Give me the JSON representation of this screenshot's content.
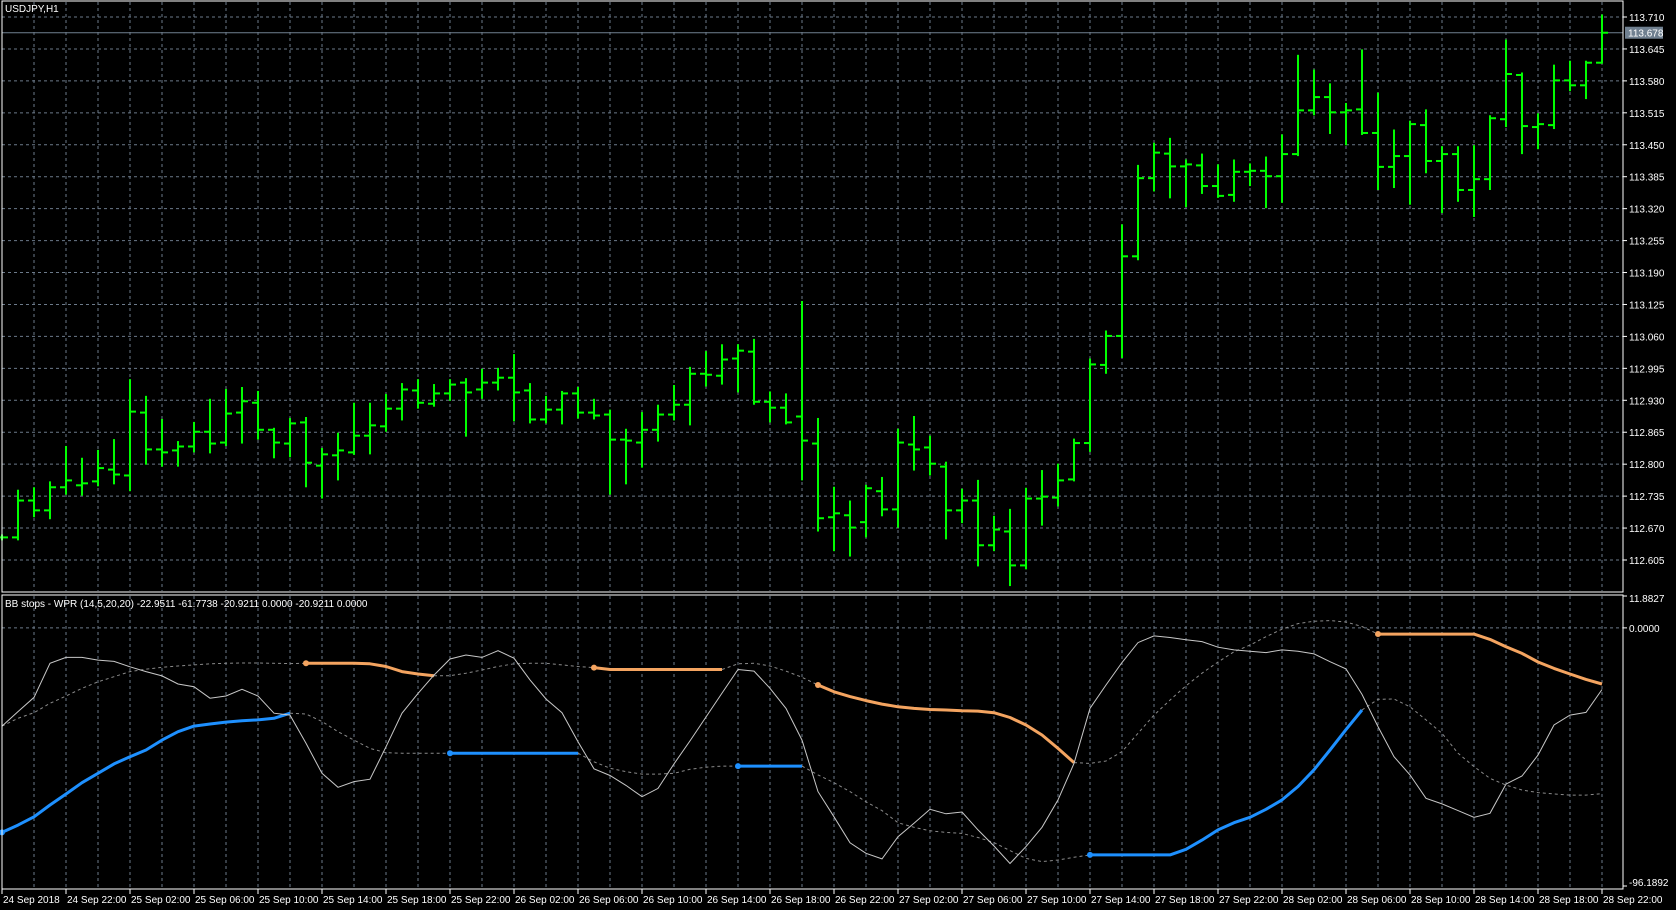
{
  "window": {
    "title": "USDJPY,H1"
  },
  "colors": {
    "background": "#000000",
    "bars": "#00ff00",
    "grid": "#6c7a8a",
    "upper_stop": "#f4a460",
    "lower_stop": "#1e90ff",
    "wpr": "#c8c8c8",
    "inactive": "#8a8a8a",
    "price_line": "#708090"
  },
  "chart_data": [
    {
      "type": "ohlc",
      "symbol": "USDJPY",
      "timeframe": "H1",
      "ylim": [
        112.605,
        113.71
      ],
      "current_price": 113.678,
      "current_price_label": "113.678",
      "y_ticks": [
        "113.710",
        "113.645",
        "113.580",
        "113.515",
        "113.450",
        "113.385",
        "113.320",
        "113.255",
        "113.190",
        "113.125",
        "113.060",
        "112.995",
        "112.930",
        "112.865",
        "112.800",
        "112.735",
        "112.670",
        "112.605"
      ],
      "x_labels": [
        "24 Sep 2018",
        "24 Sep 22:00",
        "25 Sep 02:00",
        "25 Sep 06:00",
        "25 Sep 10:00",
        "25 Sep 14:00",
        "25 Sep 18:00",
        "25 Sep 22:00",
        "26 Sep 02:00",
        "26 Sep 06:00",
        "26 Sep 10:00",
        "26 Sep 14:00",
        "26 Sep 18:00",
        "26 Sep 22:00",
        "27 Sep 02:00",
        "27 Sep 06:00",
        "27 Sep 10:00",
        "27 Sep 14:00",
        "27 Sep 18:00",
        "27 Sep 22:00",
        "28 Sep 02:00",
        "28 Sep 06:00",
        "28 Sep 10:00",
        "28 Sep 14:00",
        "28 Sep 18:00",
        "28 Sep 22:00"
      ],
      "ohlc": [
        [
          112.651,
          112.655,
          112.647,
          112.651
        ],
        [
          112.651,
          112.746,
          112.647,
          112.726
        ],
        [
          112.726,
          112.751,
          112.694,
          112.706
        ],
        [
          112.706,
          112.763,
          112.69,
          112.753
        ],
        [
          112.753,
          112.835,
          112.74,
          112.767
        ],
        [
          112.757,
          112.811,
          112.738,
          112.761
        ],
        [
          112.765,
          112.827,
          112.757,
          112.792
        ],
        [
          112.789,
          112.849,
          112.761,
          112.779
        ],
        [
          112.777,
          112.971,
          112.747,
          112.907
        ],
        [
          112.905,
          112.937,
          112.801,
          112.83
        ],
        [
          112.83,
          112.89,
          112.797,
          112.824
        ],
        [
          112.828,
          112.845,
          112.797,
          112.836
        ],
        [
          112.836,
          112.884,
          112.826,
          112.866
        ],
        [
          112.866,
          112.931,
          112.824,
          112.842
        ],
        [
          112.844,
          112.951,
          112.839,
          112.903
        ],
        [
          112.905,
          112.955,
          112.844,
          112.928
        ],
        [
          112.925,
          112.947,
          112.852,
          112.87
        ],
        [
          112.87,
          112.872,
          112.814,
          112.844
        ],
        [
          112.842,
          112.892,
          112.816,
          112.883
        ],
        [
          112.885,
          112.894,
          112.755,
          112.803
        ],
        [
          112.797,
          112.831,
          112.732,
          112.82
        ],
        [
          112.818,
          112.862,
          112.769,
          112.828
        ],
        [
          112.824,
          112.923,
          112.821,
          112.858
        ],
        [
          112.858,
          112.923,
          112.822,
          112.879
        ],
        [
          112.877,
          112.941,
          112.868,
          112.913
        ],
        [
          112.913,
          112.963,
          112.891,
          112.952
        ],
        [
          112.95,
          112.971,
          112.915,
          112.925
        ],
        [
          112.923,
          112.961,
          112.919,
          112.944
        ],
        [
          112.944,
          112.971,
          112.931,
          112.962
        ],
        [
          112.966,
          112.973,
          112.858,
          112.946
        ],
        [
          112.952,
          112.992,
          112.935,
          112.966
        ],
        [
          112.966,
          112.994,
          112.952,
          112.976
        ],
        [
          112.976,
          113.022,
          112.889,
          112.946
        ],
        [
          112.95,
          112.963,
          112.885,
          112.891
        ],
        [
          112.891,
          112.937,
          112.885,
          112.911
        ],
        [
          112.911,
          112.947,
          112.883,
          112.944
        ],
        [
          112.944,
          112.955,
          112.895,
          112.905
        ],
        [
          112.905,
          112.931,
          112.893,
          112.899
        ],
        [
          112.901,
          112.909,
          112.74,
          112.85
        ],
        [
          112.85,
          112.87,
          112.761,
          112.848
        ],
        [
          112.844,
          112.904,
          112.795,
          112.87
        ],
        [
          112.87,
          112.919,
          112.848,
          112.901
        ],
        [
          112.901,
          112.959,
          112.891,
          112.921
        ],
        [
          112.921,
          112.996,
          112.881,
          112.984
        ],
        [
          112.984,
          113.028,
          112.96,
          112.982
        ],
        [
          112.98,
          113.042,
          112.964,
          113.013
        ],
        [
          113.015,
          113.042,
          112.948,
          113.031
        ],
        [
          113.029,
          113.053,
          112.923,
          112.927
        ],
        [
          112.927,
          112.946,
          112.887,
          112.915
        ],
        [
          112.915,
          112.942,
          112.883,
          112.885
        ],
        [
          112.897,
          113.13,
          112.769,
          112.848
        ],
        [
          112.842,
          112.892,
          112.665,
          112.69
        ],
        [
          112.692,
          112.752,
          112.625,
          112.7
        ],
        [
          112.696,
          112.724,
          112.614,
          112.671
        ],
        [
          112.682,
          112.756,
          112.653,
          112.751
        ],
        [
          112.745,
          112.772,
          112.696,
          112.708
        ],
        [
          112.708,
          112.87,
          112.673,
          112.844
        ],
        [
          112.84,
          112.896,
          112.789,
          112.83
        ],
        [
          112.834,
          112.856,
          112.779,
          112.801
        ],
        [
          112.795,
          112.803,
          112.649,
          112.706
        ],
        [
          112.706,
          112.748,
          112.682,
          112.726
        ],
        [
          112.726,
          112.766,
          112.594,
          112.635
        ],
        [
          112.635,
          112.693,
          112.625,
          112.667
        ],
        [
          112.663,
          112.707,
          112.554,
          112.594
        ],
        [
          112.594,
          112.75,
          112.588,
          112.73
        ],
        [
          112.73,
          112.786,
          112.677,
          112.734
        ],
        [
          112.732,
          112.799,
          112.716,
          112.767
        ],
        [
          112.769,
          112.85,
          112.767,
          112.843
        ],
        [
          112.843,
          113.013,
          112.827,
          113.003
        ],
        [
          113.002,
          113.07,
          112.986,
          113.061
        ],
        [
          113.061,
          113.286,
          113.018,
          113.223
        ],
        [
          113.223,
          113.407,
          113.217,
          113.382
        ],
        [
          113.382,
          113.452,
          113.357,
          113.434
        ],
        [
          113.432,
          113.462,
          113.343,
          113.406
        ],
        [
          113.406,
          113.418,
          113.325,
          113.41
        ],
        [
          113.408,
          113.43,
          113.352,
          113.366
        ],
        [
          113.366,
          113.408,
          113.344,
          113.346
        ],
        [
          113.348,
          113.418,
          113.336,
          113.395
        ],
        [
          113.395,
          113.41,
          113.368,
          113.397
        ],
        [
          113.397,
          113.424,
          113.323,
          113.386
        ],
        [
          113.386,
          113.469,
          113.334,
          113.431
        ],
        [
          113.431,
          113.631,
          113.429,
          113.52
        ],
        [
          113.52,
          113.601,
          113.512,
          113.547
        ],
        [
          113.547,
          113.573,
          113.474,
          113.516
        ],
        [
          113.516,
          113.533,
          113.451,
          113.52
        ],
        [
          113.522,
          113.642,
          113.472,
          113.474
        ],
        [
          113.474,
          113.554,
          113.36,
          113.405
        ],
        [
          113.405,
          113.479,
          113.364,
          113.427
        ],
        [
          113.427,
          113.497,
          113.33,
          113.492
        ],
        [
          113.49,
          113.52,
          113.394,
          113.417
        ],
        [
          113.417,
          113.445,
          113.313,
          113.431
        ],
        [
          113.431,
          113.445,
          113.336,
          113.358
        ],
        [
          113.358,
          113.447,
          113.305,
          113.38
        ],
        [
          113.38,
          113.508,
          113.36,
          113.504
        ],
        [
          113.502,
          113.662,
          113.488,
          113.594
        ],
        [
          113.592,
          113.595,
          113.433,
          113.488
        ],
        [
          113.486,
          113.512,
          113.443,
          113.492
        ],
        [
          113.49,
          113.611,
          113.484,
          113.581
        ],
        [
          113.581,
          113.619,
          113.561,
          113.571
        ],
        [
          113.571,
          113.619,
          113.545,
          113.617
        ],
        [
          113.617,
          113.713,
          113.617,
          113.678
        ]
      ]
    },
    {
      "type": "line",
      "legend": "BB stops - WPR (14,5,20,20) -22.9511 -61.7738 -20.9211 0.0000 -20.9211 0.0000",
      "ylim": [
        -96.1892,
        11.8827
      ],
      "y_labels": [
        "11.8827",
        "0.0000",
        "-96.1892"
      ],
      "grid_levels": [
        0
      ],
      "series": [
        {
          "name": "WPR",
          "values": [
            -36.6,
            -31.2,
            -25.9,
            -13.2,
            -11.0,
            -11.0,
            -12.0,
            -12.5,
            -14.5,
            -16.3,
            -17.9,
            -20.9,
            -21.9,
            -26.2,
            -25.4,
            -22.9,
            -25.4,
            -31.8,
            -32.5,
            -43.0,
            -54.2,
            -59.4,
            -57.3,
            -56.4,
            -44.3,
            -31.8,
            -24.4,
            -17.6,
            -11.6,
            -10.1,
            -11.0,
            -8.5,
            -11.3,
            -19.4,
            -26.5,
            -31.6,
            -42.4,
            -52.5,
            -55.0,
            -58.7,
            -62.9,
            -59.8,
            -50.7,
            -42.1,
            -33.2,
            -24.3,
            -15.5,
            -16.1,
            -22.5,
            -30.0,
            -41.8,
            -61.0,
            -70.4,
            -80.1,
            -84.0,
            -86.1,
            -77.8,
            -72.8,
            -67.6,
            -69.3,
            -68.6,
            -75.3,
            -81.3,
            -87.8,
            -81.5,
            -74.3,
            -64.1,
            -50.5,
            -30.0,
            -21.3,
            -12.9,
            -5.5,
            -3.0,
            -3.6,
            -4.4,
            -5.1,
            -7.2,
            -8.2,
            -8.7,
            -9.2,
            -8.2,
            -8.7,
            -9.7,
            -12.6,
            -15.3,
            -24.8,
            -36.8,
            -48.0,
            -54.8,
            -63.5,
            -65.6,
            -68.1,
            -70.6,
            -69.1,
            -58.2,
            -55.2,
            -47.4,
            -36.2,
            -32.5,
            -31.5,
            -22.9511
          ]
        },
        {
          "name": "Upper stop",
          "active_ranges": [
            [
              19,
              27
            ],
            [
              37,
              45
            ],
            [
              51,
              67
            ],
            [
              86,
              100
            ]
          ],
          "values": [
            -36.6,
            -33.7,
            -31.6,
            -28.1,
            -25.4,
            -22.5,
            -20.1,
            -18.2,
            -16.3,
            -15.4,
            -14.7,
            -14.2,
            -13.8,
            -13.4,
            -13.2,
            -13.1,
            -13.1,
            -13.2,
            -13.3,
            -13.2,
            -13.2,
            -13.2,
            -13.2,
            -13.4,
            -14.4,
            -16.3,
            -17.2,
            -17.8,
            -17.8,
            -16.9,
            -15.7,
            -14.4,
            -13.4,
            -13.2,
            -13.2,
            -13.8,
            -14.4,
            -14.8,
            -15.5,
            -15.5,
            -15.5,
            -15.5,
            -15.5,
            -15.5,
            -15.5,
            -15.5,
            -13.4,
            -13.2,
            -14.2,
            -16.1,
            -18.4,
            -21.3,
            -23.8,
            -25.6,
            -27.1,
            -28.4,
            -29.4,
            -30.0,
            -30.4,
            -30.6,
            -30.9,
            -31.0,
            -31.6,
            -33.4,
            -36.2,
            -39.9,
            -44.9,
            -50.2,
            -50.5,
            -49.6,
            -46.1,
            -39.3,
            -32.5,
            -26.9,
            -21.6,
            -16.9,
            -12.7,
            -8.9,
            -6.4,
            -3.3,
            -0.5,
            1.6,
            2.5,
            2.7,
            2.2,
            0.5,
            -2.3,
            -2.3,
            -2.3,
            -2.3,
            -2.3,
            -2.3,
            -2.3,
            -4.3,
            -7.0,
            -9.5,
            -12.7,
            -15.1,
            -17.2,
            -19.2,
            -20.9211
          ]
        },
        {
          "name": "Lower stop",
          "active_ranges": [
            [
              0,
              18
            ],
            [
              28,
              36
            ],
            [
              46,
              50
            ],
            [
              68,
              85
            ]
          ],
          "values": [
            -76.2,
            -73.5,
            -70.4,
            -66.0,
            -61.9,
            -57.7,
            -54.2,
            -50.7,
            -48.0,
            -45.5,
            -41.8,
            -38.7,
            -36.6,
            -35.8,
            -35.1,
            -34.6,
            -34.3,
            -33.7,
            -31.8,
            -32.1,
            -34.9,
            -38.7,
            -41.8,
            -44.9,
            -46.5,
            -46.7,
            -46.7,
            -46.7,
            -46.7,
            -46.7,
            -46.7,
            -46.7,
            -46.7,
            -46.7,
            -46.7,
            -46.7,
            -46.7,
            -49.9,
            -52.3,
            -53.6,
            -54.5,
            -54.5,
            -54.2,
            -52.7,
            -51.9,
            -51.5,
            -51.5,
            -51.5,
            -51.5,
            -51.5,
            -51.5,
            -54.8,
            -57.7,
            -61.0,
            -64.8,
            -68.1,
            -72.6,
            -74.3,
            -75.6,
            -76.2,
            -76.6,
            -78.1,
            -80.0,
            -83.0,
            -85.9,
            -87.1,
            -86.5,
            -85.5,
            -84.6,
            -84.6,
            -84.6,
            -84.6,
            -84.6,
            -84.6,
            -82.5,
            -79.1,
            -75.3,
            -72.6,
            -70.6,
            -67.6,
            -64.1,
            -59.1,
            -52.9,
            -45.5,
            -37.9,
            -30.6,
            -26.6,
            -26.5,
            -29.4,
            -34.3,
            -39.3,
            -46.7,
            -51.7,
            -56.1,
            -58.6,
            -60.4,
            -61.4,
            -61.9,
            -62.3,
            -62.3,
            -61.7738
          ]
        }
      ]
    }
  ]
}
